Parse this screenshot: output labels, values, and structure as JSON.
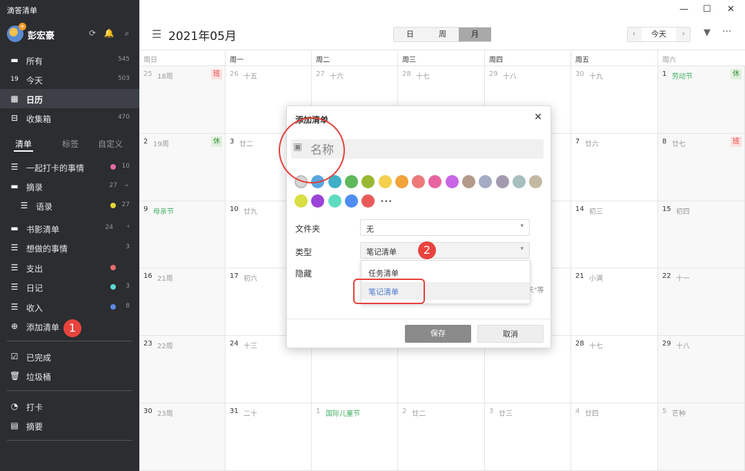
{
  "app": {
    "title": "滴答清单"
  },
  "user": {
    "name": "彭宏豪"
  },
  "sidebar": {
    "smart": [
      {
        "label": "所有",
        "count": "545",
        "icon": "inbox-tray-icon"
      },
      {
        "label": "今天",
        "count": "503",
        "icon": "calendar-today-icon"
      },
      {
        "label": "日历",
        "count": "",
        "icon": "calendar-icon"
      },
      {
        "label": "收集箱",
        "count": "470",
        "icon": "inbox-icon"
      }
    ],
    "tabs": [
      "清单",
      "标签",
      "自定义"
    ],
    "lists": [
      {
        "label": "一起打卡的事情",
        "count": "10",
        "color": "#e86aa4"
      },
      {
        "label": "摘录",
        "count": "27"
      },
      {
        "label": "语录",
        "count": "27",
        "color": "#e6d43a"
      },
      {
        "label": "书影清单",
        "count": "24"
      },
      {
        "label": "想做的事情",
        "count": "3"
      },
      {
        "label": "支出",
        "count": "",
        "color": "#e86a6a"
      },
      {
        "label": "日记",
        "count": "3",
        "color": "#5ed8d2"
      },
      {
        "label": "收入",
        "count": "8",
        "color": "#5b88e6"
      }
    ],
    "add_list": "添加清单",
    "bottom": [
      {
        "label": "已完成"
      },
      {
        "label": "垃圾桶"
      }
    ],
    "tools": [
      {
        "label": "打卡"
      },
      {
        "label": "摘要"
      }
    ]
  },
  "badges": {
    "one": "1",
    "two": "2"
  },
  "header": {
    "month": "2021年05月",
    "views": [
      "日",
      "周",
      "月"
    ],
    "today": "今天"
  },
  "calendar": {
    "weekdays": [
      "周日",
      "周一",
      "周二",
      "周三",
      "周四",
      "周五",
      "周六"
    ],
    "weeks": [
      [
        {
          "d": "25",
          "l": "18周",
          "tag": "班",
          "dim": true
        },
        {
          "d": "26",
          "l": "十五",
          "dim": true
        },
        {
          "d": "27",
          "l": "十六",
          "dim": true
        },
        {
          "d": "28",
          "l": "十七",
          "dim": true
        },
        {
          "d": "29",
          "l": "十八",
          "dim": true
        },
        {
          "d": "30",
          "l": "十九",
          "dim": true
        },
        {
          "d": "1",
          "l": "劳动节",
          "tag": "休",
          "holiday": true
        }
      ],
      [
        {
          "d": "2",
          "l": "19周",
          "tag": "休"
        },
        {
          "d": "3",
          "l": "廿二"
        },
        {
          "d": "",
          "l": ""
        },
        {
          "d": "",
          "l": ""
        },
        {
          "d": "",
          "l": ""
        },
        {
          "d": "7",
          "l": "廿六"
        },
        {
          "d": "8",
          "l": "廿七",
          "tag": "班"
        }
      ],
      [
        {
          "d": "9",
          "l": "母亲节",
          "holiday": true
        },
        {
          "d": "10",
          "l": "廿九"
        },
        {
          "d": "",
          "l": ""
        },
        {
          "d": "",
          "l": ""
        },
        {
          "d": "",
          "l": ""
        },
        {
          "d": "14",
          "l": "初三"
        },
        {
          "d": "15",
          "l": "初四"
        }
      ],
      [
        {
          "d": "16",
          "l": "21周"
        },
        {
          "d": "17",
          "l": "初六"
        },
        {
          "d": "",
          "l": ""
        },
        {
          "d": "",
          "l": ""
        },
        {
          "d": "",
          "l": ""
        },
        {
          "d": "21",
          "l": "小满"
        },
        {
          "d": "22",
          "l": "十一"
        }
      ],
      [
        {
          "d": "23",
          "l": "22周"
        },
        {
          "d": "24",
          "l": "十三"
        },
        {
          "d": "",
          "l": ""
        },
        {
          "d": "",
          "l": ""
        },
        {
          "d": "",
          "l": ""
        },
        {
          "d": "28",
          "l": "十七"
        },
        {
          "d": "29",
          "l": "十八"
        }
      ],
      [
        {
          "d": "30",
          "l": "23周"
        },
        {
          "d": "31",
          "l": "二十"
        },
        {
          "d": "1",
          "l": "国际儿童节",
          "holiday": true,
          "dim": true
        },
        {
          "d": "2",
          "l": "廿二",
          "dim": true
        },
        {
          "d": "3",
          "l": "廿三",
          "dim": true
        },
        {
          "d": "4",
          "l": "廿四",
          "dim": true
        },
        {
          "d": "5",
          "l": "芒种",
          "dim": true
        }
      ]
    ]
  },
  "dialog": {
    "title": "添加清单",
    "name_placeholder": "名称",
    "colors": [
      "#d6d6d6",
      "#57a6e0",
      "#3fb0c8",
      "#5fb85a",
      "#9ab833",
      "#f5d04f",
      "#f2a33a",
      "#ec7a7a",
      "#e864a0",
      "#c865e6",
      "#b49a8a",
      "#a4abc4",
      "#a49ab0",
      "#a8bfbf",
      "#c3b9a0",
      "#d8de44",
      "#9b44d8",
      "#5fdcc0",
      "#4f8ef0",
      "#e85a5a"
    ],
    "folder_label": "文件夹",
    "folder_value": "无",
    "type_label": "类型",
    "type_value": "笔记清单",
    "hide_label": "隐藏",
    "type_options": [
      "任务清单",
      "笔记清单"
    ],
    "hint": "天\"等",
    "save": "保存",
    "cancel": "取消"
  }
}
